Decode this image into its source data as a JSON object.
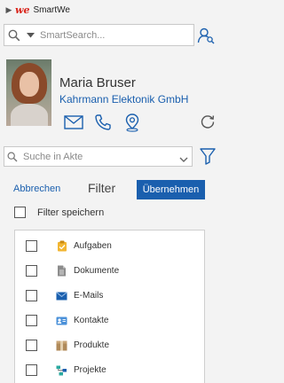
{
  "titlebar": {
    "logo": "we",
    "title": "SmartWe"
  },
  "search": {
    "placeholder": "SmartSearch..."
  },
  "contact": {
    "name": "Maria Bruser",
    "company": "Kahrmann Elektonik GmbH"
  },
  "akte_search": {
    "placeholder": "Suche in Akte"
  },
  "filter": {
    "cancel_label": "Abbrechen",
    "title": "Filter",
    "apply_label": "Übernehmen",
    "save_label": "Filter speichern",
    "items": [
      {
        "label": "Aufgaben",
        "icon": "task-icon"
      },
      {
        "label": "Dokumente",
        "icon": "document-icon"
      },
      {
        "label": "E-Mails",
        "icon": "email-icon"
      },
      {
        "label": "Kontakte",
        "icon": "contact-card-icon"
      },
      {
        "label": "Produkte",
        "icon": "product-box-icon"
      },
      {
        "label": "Projekte",
        "icon": "project-icon"
      }
    ]
  },
  "colors": {
    "accent": "#1a5fae",
    "brand": "#d9261c"
  }
}
